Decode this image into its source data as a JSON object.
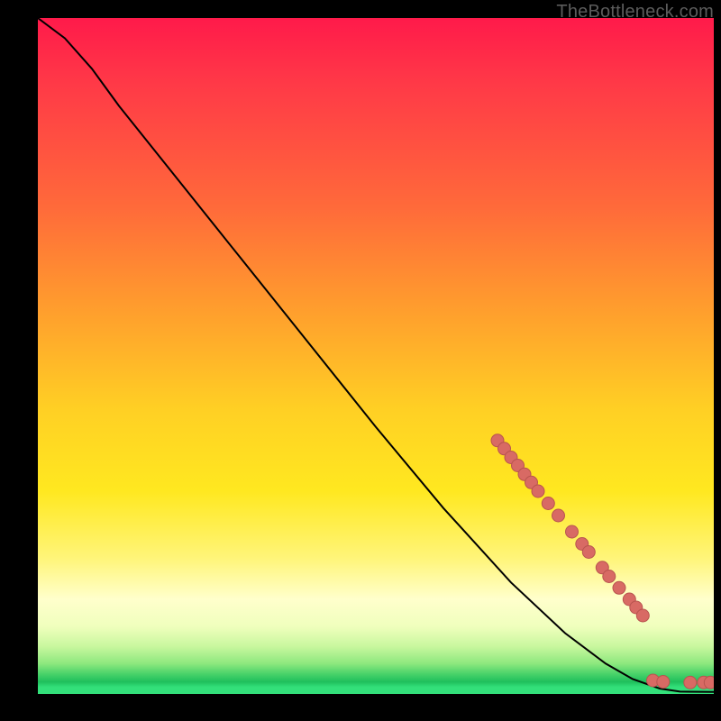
{
  "attribution": "TheBottleneck.com",
  "colors": {
    "page_bg": "#000000",
    "curve": "#000000",
    "marker_fill": "#d86a64",
    "marker_stroke": "#b8544f",
    "gradient_stops": [
      "#ff1a4a",
      "#ff6a3a",
      "#ffd024",
      "#ffffcc",
      "#33e07a"
    ]
  },
  "chart_data": {
    "type": "line",
    "title": "",
    "xlabel": "",
    "ylabel": "",
    "xlim": [
      0,
      100
    ],
    "ylim": [
      0,
      100
    ],
    "grid": false,
    "legend": false,
    "curve": [
      {
        "x": 0,
        "y": 100
      },
      {
        "x": 4,
        "y": 97
      },
      {
        "x": 8,
        "y": 92.5
      },
      {
        "x": 12,
        "y": 87
      },
      {
        "x": 20,
        "y": 77
      },
      {
        "x": 30,
        "y": 64.5
      },
      {
        "x": 40,
        "y": 52
      },
      {
        "x": 50,
        "y": 39.5
      },
      {
        "x": 60,
        "y": 27.5
      },
      {
        "x": 70,
        "y": 16.5
      },
      {
        "x": 78,
        "y": 9
      },
      {
        "x": 84,
        "y": 4.5
      },
      {
        "x": 88,
        "y": 2.2
      },
      {
        "x": 92,
        "y": 0.8
      },
      {
        "x": 95,
        "y": 0.35
      },
      {
        "x": 100,
        "y": 0.3
      }
    ],
    "markers": [
      {
        "x": 68.0,
        "y": 37.5
      },
      {
        "x": 69.0,
        "y": 36.3
      },
      {
        "x": 70.0,
        "y": 35.0
      },
      {
        "x": 71.0,
        "y": 33.8
      },
      {
        "x": 72.0,
        "y": 32.5
      },
      {
        "x": 73.0,
        "y": 31.3
      },
      {
        "x": 74.0,
        "y": 30.0
      },
      {
        "x": 75.5,
        "y": 28.2
      },
      {
        "x": 77.0,
        "y": 26.4
      },
      {
        "x": 79.0,
        "y": 24.0
      },
      {
        "x": 80.5,
        "y": 22.2
      },
      {
        "x": 81.5,
        "y": 21.0
      },
      {
        "x": 83.5,
        "y": 18.7
      },
      {
        "x": 84.5,
        "y": 17.4
      },
      {
        "x": 86.0,
        "y": 15.7
      },
      {
        "x": 87.5,
        "y": 14.0
      },
      {
        "x": 88.5,
        "y": 12.8
      },
      {
        "x": 89.5,
        "y": 11.6
      },
      {
        "x": 91.0,
        "y": 2.0
      },
      {
        "x": 92.5,
        "y": 1.8
      },
      {
        "x": 96.5,
        "y": 1.7
      },
      {
        "x": 98.5,
        "y": 1.7
      },
      {
        "x": 99.5,
        "y": 1.7
      }
    ]
  }
}
